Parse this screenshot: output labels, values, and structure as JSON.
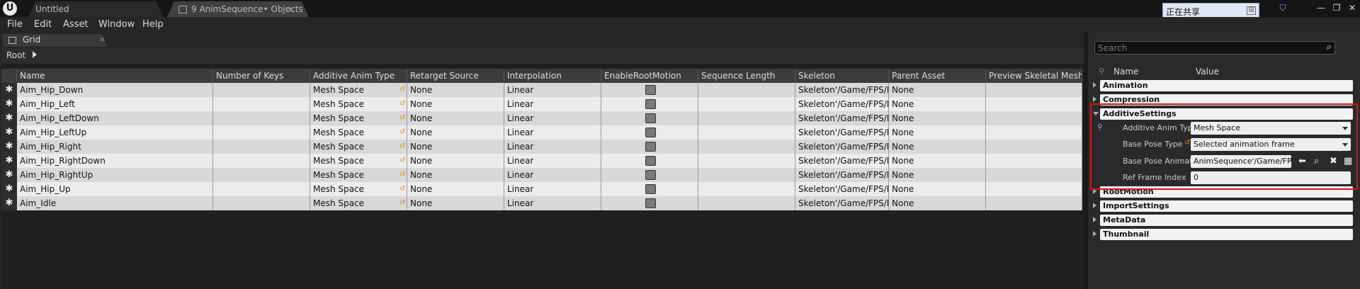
{
  "titlebar": {
    "logo_text": "U",
    "tabs": [
      {
        "label": "Untitled",
        "active": false
      },
      {
        "label": "9 AnimSequence• Objects",
        "active": true
      }
    ],
    "tab_close": "×"
  },
  "share_panel": {
    "title": "正在共享",
    "close": "☒",
    "icons": [
      "hand-icon",
      "dropdown-icon",
      "chat-icon",
      "board-icon",
      "stop-share-icon"
    ]
  },
  "window_controls": {
    "minimize": "—",
    "restore": "❐",
    "close": "✕"
  },
  "menu": {
    "items": [
      "File",
      "Edit",
      "Asset",
      "Window",
      "Help"
    ]
  },
  "grid_tab": {
    "label": "Grid",
    "close": "×"
  },
  "breadcrumb": {
    "root": "Root"
  },
  "table": {
    "columns": [
      "Name",
      "Number of Keys",
      "Additive Anim Type",
      "Retarget Source",
      "Interpolation",
      "EnableRootMotion",
      "Sequence Length",
      "Skeleton",
      "Parent Asset",
      "Preview Skeletal Mesh"
    ],
    "rows": [
      {
        "name": "Aim_Hip_Down",
        "keys": "",
        "additive": "Mesh Space",
        "retarget": "None",
        "interp": "Linear",
        "root_motion": false,
        "seq_len": "",
        "skeleton": "Skeleton'/Game/FPS/M",
        "parent": "None",
        "preview": ""
      },
      {
        "name": "Aim_Hip_Left",
        "keys": "",
        "additive": "Mesh Space",
        "retarget": "None",
        "interp": "Linear",
        "root_motion": false,
        "seq_len": "",
        "skeleton": "Skeleton'/Game/FPS/M",
        "parent": "None",
        "preview": ""
      },
      {
        "name": "Aim_Hip_LeftDown",
        "keys": "",
        "additive": "Mesh Space",
        "retarget": "None",
        "interp": "Linear",
        "root_motion": false,
        "seq_len": "",
        "skeleton": "Skeleton'/Game/FPS/M",
        "parent": "None",
        "preview": ""
      },
      {
        "name": "Aim_Hip_LeftUp",
        "keys": "",
        "additive": "Mesh Space",
        "retarget": "None",
        "interp": "Linear",
        "root_motion": false,
        "seq_len": "",
        "skeleton": "Skeleton'/Game/FPS/M",
        "parent": "None",
        "preview": ""
      },
      {
        "name": "Aim_Hip_Right",
        "keys": "",
        "additive": "Mesh Space",
        "retarget": "None",
        "interp": "Linear",
        "root_motion": false,
        "seq_len": "",
        "skeleton": "Skeleton'/Game/FPS/M",
        "parent": "None",
        "preview": ""
      },
      {
        "name": "Aim_Hip_RightDown",
        "keys": "",
        "additive": "Mesh Space",
        "retarget": "None",
        "interp": "Linear",
        "root_motion": false,
        "seq_len": "",
        "skeleton": "Skeleton'/Game/FPS/M",
        "parent": "None",
        "preview": ""
      },
      {
        "name": "Aim_Hip_RightUp",
        "keys": "",
        "additive": "Mesh Space",
        "retarget": "None",
        "interp": "Linear",
        "root_motion": false,
        "seq_len": "",
        "skeleton": "Skeleton'/Game/FPS/M",
        "parent": "None",
        "preview": ""
      },
      {
        "name": "Aim_Hip_Up",
        "keys": "",
        "additive": "Mesh Space",
        "retarget": "None",
        "interp": "Linear",
        "root_motion": false,
        "seq_len": "",
        "skeleton": "Skeleton'/Game/FPS/M",
        "parent": "None",
        "preview": ""
      },
      {
        "name": "Aim_Idle",
        "keys": "",
        "additive": "Mesh Space",
        "retarget": "None",
        "interp": "Linear",
        "root_motion": false,
        "seq_len": "",
        "skeleton": "Skeleton'/Game/FPS/M",
        "parent": "None",
        "preview": ""
      }
    ],
    "row_head_glyph": "✱",
    "stripe_colors": [
      "#d8d8d8",
      "#ececec"
    ]
  },
  "details": {
    "search_placeholder": "Search",
    "header": {
      "name": "Name",
      "value": "Value"
    },
    "categories": {
      "animation": "Animation",
      "compression": "Compression",
      "additive": "AdditiveSettings",
      "rootmotion": "RootMotion",
      "import": "ImportSettings",
      "metadata": "MetaData",
      "thumbnail": "Thumbnail"
    },
    "props": {
      "additive_type_label": "Additive Anim Type",
      "additive_type_value": "Mesh Space",
      "base_pose_type_label": "Base Pose Type",
      "base_pose_type_value": "Selected animation frame",
      "base_pose_anim_label": "Base Pose Animation",
      "base_pose_anim_value": "AnimSequence'/Game/FPS",
      "ref_frame_label": "Ref Frame Index",
      "ref_frame_value": "0"
    },
    "highlight_color": "#d01818"
  }
}
